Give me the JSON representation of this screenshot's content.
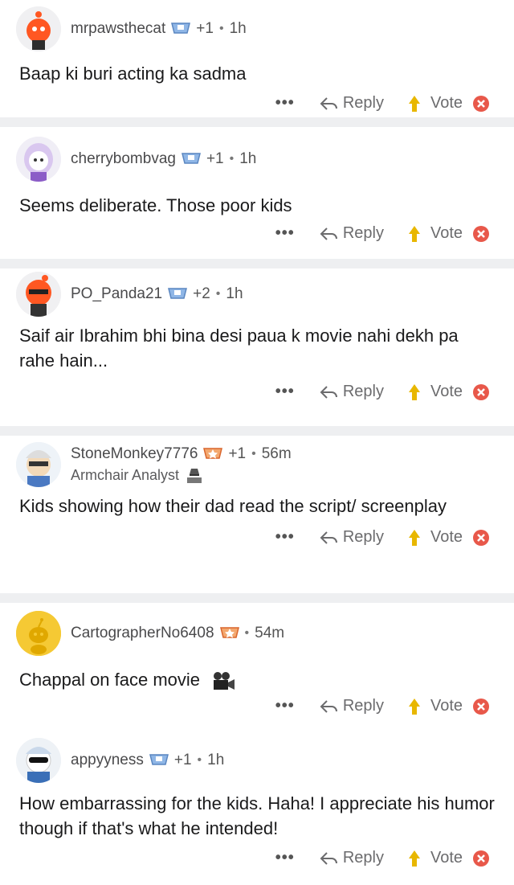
{
  "actions": {
    "more": "•••",
    "reply": "Reply",
    "vote": "Vote"
  },
  "comments": [
    {
      "user": "mrpawsthecat",
      "karma": "+1",
      "dot": "•",
      "age": "1h",
      "text": "Baap ki buri acting ka sadma"
    },
    {
      "user": "cherrybombvag",
      "karma": "+1",
      "dot": "•",
      "age": "1h",
      "text": "Seems deliberate. Those poor kids"
    },
    {
      "user": "PO_Panda21",
      "karma": "+2",
      "dot": "•",
      "age": "1h",
      "text": "Saif air Ibrahim bhi bina desi paua k movie nahi dekh pa rahe hain..."
    },
    {
      "user": "StoneMonkey7776",
      "karma": "+1",
      "dot": "•",
      "age": "56m",
      "flair": "Armchair Analyst",
      "text": "Kids showing how their dad read the script/ screenplay"
    },
    {
      "user": "CartographerNo6408",
      "karma": "",
      "dot": "•",
      "age": "54m",
      "text": "Chappal on face movie"
    },
    {
      "user": "appyyness",
      "karma": "+1",
      "dot": "•",
      "age": "1h",
      "text": "How embarrassing for the kids. Haha! I appreciate his humor though if that's what he intended!"
    }
  ],
  "icons": {
    "badge": "trophy-badge-icon",
    "reply": "reply-arrow-icon",
    "upvote": "upvote-arrow-icon",
    "downvote": "downvote-icon",
    "flair": "incognito-icon",
    "movie": "movie-camera-icon"
  },
  "colors": {
    "separator": "#eeeff1",
    "downvote": "#e8584a",
    "upvote": "#e8b700",
    "badge_blue": "#6a9bd8",
    "badge_orange": "#e9773b"
  }
}
